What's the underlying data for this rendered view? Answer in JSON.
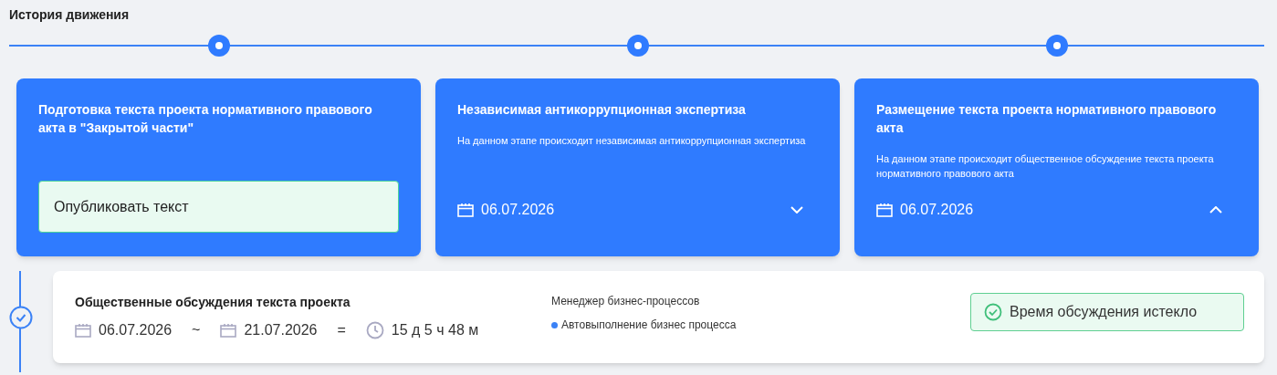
{
  "title": "История движения",
  "stages": [
    {
      "kind": "action",
      "title": "Подготовка текста проекта нормативного правового акта в \"Закрытой части\"",
      "action": "Опубликовать текст"
    },
    {
      "kind": "info",
      "title": "Независимая антикоррупционная экспертиза",
      "description": "На данном этапе происходит независимая антикоррупционная экспертиза",
      "date": "06.07.2026",
      "expanded": false
    },
    {
      "kind": "info",
      "title": "Размещение текста проекта нормативного правового акта",
      "description": "На данном этапе происходит общественное обсуждение текста проекта нормативного правового акта",
      "date": "06.07.2026",
      "expanded": true
    }
  ],
  "detail": {
    "title": "Общественные обсуждения текста проекта",
    "start": "06.07.2026",
    "range_sep": "~",
    "end": "21.07.2026",
    "equals": "=",
    "duration": "15 д 5 ч 48 м",
    "role": "Менеджер бизнес-процессов",
    "executor": "Автовыполнение бизнес процесса",
    "status": "Время обсуждения истекло",
    "done": true
  }
}
